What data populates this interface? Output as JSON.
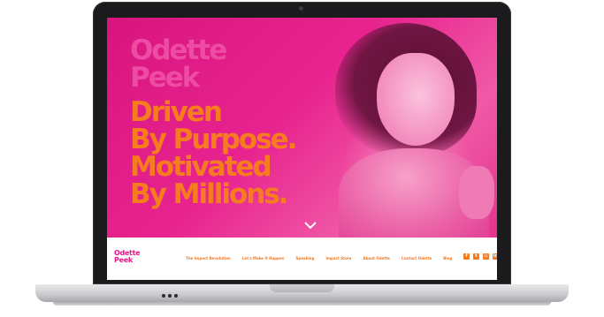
{
  "hero": {
    "name_line1": "Odette",
    "name_line2": "Peek",
    "tagline": [
      "Driven",
      "By Purpose.",
      "Motivated",
      "By Millions."
    ],
    "scroll_icon": "chevron-down-icon"
  },
  "nav": {
    "logo_line1": "Odette",
    "logo_line2": "Peek",
    "items": [
      "The Impact Revolution",
      "Let's Make It Happen",
      "Speaking",
      "Impact Store",
      "About Odette",
      "Contact Odette",
      "Blog"
    ],
    "social": [
      {
        "name": "facebook-icon",
        "glyph": "f"
      },
      {
        "name": "twitter-icon",
        "glyph": "t"
      },
      {
        "name": "instagram-icon",
        "glyph": "◎"
      },
      {
        "name": "linkedin-icon",
        "glyph": "in"
      }
    ]
  },
  "colors": {
    "brand_pink": "#e5178a",
    "accent_orange": "#f07a22"
  }
}
